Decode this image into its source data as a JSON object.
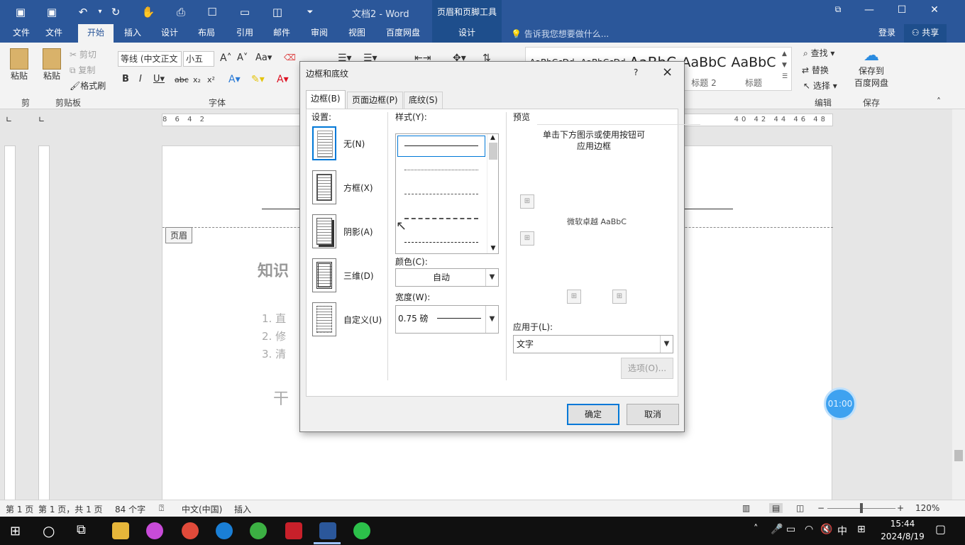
{
  "title_bar": {
    "doc_title": "文档2 - Word",
    "context_title": "页眉和页脚工具"
  },
  "tabs": {
    "file": "文件",
    "file2": "文件",
    "home": "开始",
    "insert": "插入",
    "design": "设计",
    "layout": "布局",
    "references": "引用",
    "mailings": "邮件",
    "review": "审阅",
    "view": "视图",
    "baidu": "百度网盘",
    "hf_design": "设计",
    "tell_me": "告诉我您想要做什么...",
    "login": "登录",
    "share": "共享"
  },
  "ribbon": {
    "paste1": "粘贴",
    "paste2": "粘贴",
    "cut": "剪切",
    "copy": "复制",
    "format_painter": "格式刷",
    "clipboard_group": "剪贴板",
    "clip_short": "剪",
    "font_name": "等线 (中文正文",
    "font_size": "小五",
    "font_group": "字体",
    "style_1": "AaBbCcDd",
    "style_2": "AaBbCcDd",
    "style_3": "AaBbC",
    "style_4": "AaBbC",
    "style_5": "AaBbC",
    "style_4_name": "标题 2",
    "style_5_name": "标题",
    "find": "查找",
    "replace": "替换",
    "select": "选择",
    "edit_group": "编辑",
    "save_to": "保存到",
    "baidu_pan": "百度网盘",
    "save_group": "保存"
  },
  "ruler": {
    "left_marks": "8 6 4 2",
    "right_marks": "40 42 44 46 48"
  },
  "document": {
    "header_tag": "页眉",
    "heading": "知识",
    "list": [
      "1. 直",
      "2. 修",
      "3. 清"
    ],
    "body_text": "干"
  },
  "dialog": {
    "title": "边框和底纹",
    "help": "?",
    "close": "×",
    "tab_border": "边框(B)",
    "tab_page_border": "页面边框(P)",
    "tab_shading": "底纹(S)",
    "setting_label": "设置:",
    "settings": [
      "无(N)",
      "方框(X)",
      "阴影(A)",
      "三维(D)",
      "自定义(U)"
    ],
    "style_label": "样式(Y):",
    "color_label": "颜色(C):",
    "color_value": "自动",
    "width_label": "宽度(W):",
    "width_value": "0.75 磅",
    "preview_label": "预览",
    "preview_hint": "单击下方图示或使用按钮可应用边框",
    "preview_text": "微软卓越  AaBbC",
    "apply_label": "应用于(L):",
    "apply_value": "文字",
    "options_btn": "选项(O)...",
    "ok_btn": "确定",
    "cancel_btn": "取消"
  },
  "status": {
    "page": "第 1 页",
    "page_of": "第 1 页，共 1 页",
    "words": "84 个字",
    "lang": "中文(中国)",
    "mode": "插入",
    "zoom": "120%"
  },
  "taskbar": {
    "ime": "中",
    "time": "15:44",
    "date": "2024/8/19"
  },
  "timer": "01:00"
}
